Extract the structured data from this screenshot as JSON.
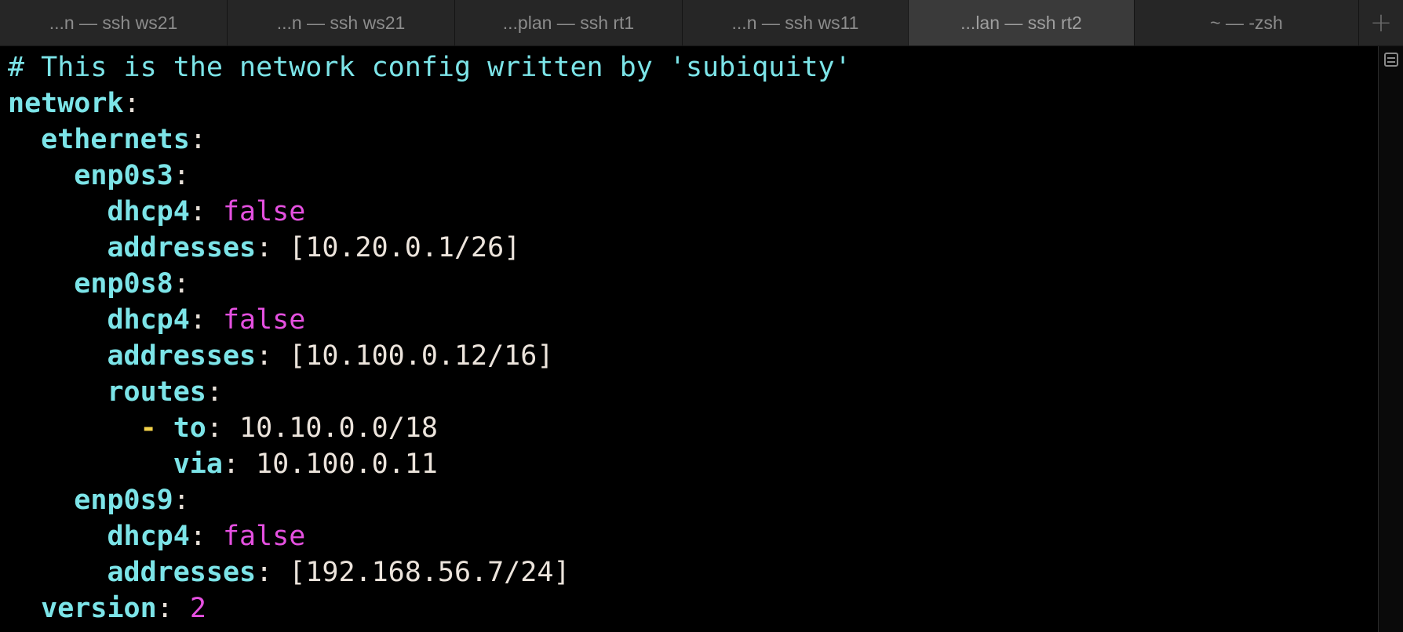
{
  "tabs": [
    {
      "label": "...n — ssh ws21",
      "active": false
    },
    {
      "label": "...n — ssh ws21",
      "active": false
    },
    {
      "label": "...plan — ssh rt1",
      "active": false
    },
    {
      "label": "...n — ssh ws11",
      "active": false
    },
    {
      "label": "...lan — ssh rt2",
      "active": true
    },
    {
      "label": "~ — -zsh",
      "active": false
    }
  ],
  "add_tab_label": "+",
  "icons": {
    "add_tab": "plus-icon",
    "scroll_marker": "split-pane-icon"
  },
  "colors": {
    "key": "#7ce4e8",
    "boolean": "#e550e0",
    "dash": "#f2d24a",
    "text": "#e8e0d8",
    "background": "#000000"
  },
  "terminal": {
    "lines": [
      {
        "indent": "",
        "comment": "# This is the network config written by 'subiquity'"
      },
      {
        "indent": "",
        "key": "network",
        "sep": ":"
      },
      {
        "indent": "  ",
        "key": "ethernets",
        "sep": ":"
      },
      {
        "indent": "    ",
        "key": "enp0s3",
        "sep": ":"
      },
      {
        "indent": "      ",
        "key": "dhcp4",
        "sep": ": ",
        "bool": "false"
      },
      {
        "indent": "      ",
        "key": "addresses",
        "sep": ": ",
        "value": "[10.20.0.1/26]"
      },
      {
        "indent": "    ",
        "key": "enp0s8",
        "sep": ":"
      },
      {
        "indent": "      ",
        "key": "dhcp4",
        "sep": ": ",
        "bool": "false"
      },
      {
        "indent": "      ",
        "key": "addresses",
        "sep": ": ",
        "value": "[10.100.0.12/16]"
      },
      {
        "indent": "      ",
        "key": "routes",
        "sep": ":"
      },
      {
        "indent": "        ",
        "dash": "- ",
        "key": "to",
        "sep": ": ",
        "value": "10.10.0.0/18"
      },
      {
        "indent": "          ",
        "key": "via",
        "sep": ": ",
        "value": "10.100.0.11"
      },
      {
        "indent": "    ",
        "key": "enp0s9",
        "sep": ":"
      },
      {
        "indent": "      ",
        "key": "dhcp4",
        "sep": ": ",
        "bool": "false"
      },
      {
        "indent": "      ",
        "key": "addresses",
        "sep": ": ",
        "value": "[192.168.56.7/24]"
      },
      {
        "indent": "  ",
        "key": "version",
        "sep": ": ",
        "num": "2"
      }
    ]
  }
}
